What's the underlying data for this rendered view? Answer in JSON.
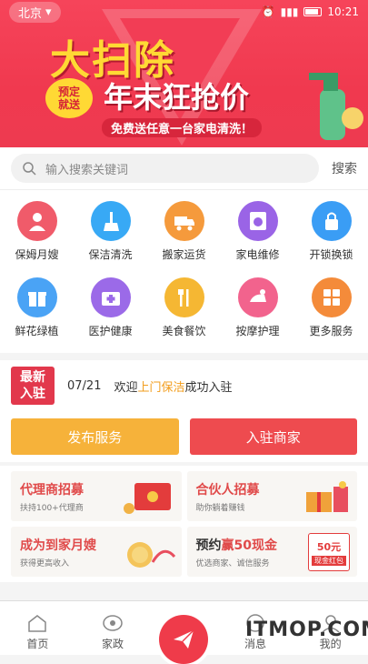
{
  "status_bar": {
    "location": "北京",
    "time": "10:21"
  },
  "banner": {
    "headline": "大扫除",
    "badge_line1": "预定",
    "badge_line2": "就送",
    "subheadline": "年末狂抢价",
    "promo": "免费送任意一台家电清洗！"
  },
  "search": {
    "placeholder": "输入搜索关键词",
    "button": "搜索"
  },
  "services": [
    {
      "label": "保姆月嫂",
      "color": "#f05b6a",
      "icon": "person-icon"
    },
    {
      "label": "保洁清洗",
      "color": "#38a9f5",
      "icon": "broom-icon"
    },
    {
      "label": "搬家运货",
      "color": "#f59a3c",
      "icon": "truck-icon"
    },
    {
      "label": "家电维修",
      "color": "#9a64e6",
      "icon": "washer-icon"
    },
    {
      "label": "开锁换锁",
      "color": "#3a9df5",
      "icon": "lock-icon"
    },
    {
      "label": "鲜花绿植",
      "color": "#4aa3f5",
      "icon": "gift-icon"
    },
    {
      "label": "医护健康",
      "color": "#9b6ae8",
      "icon": "medkit-icon"
    },
    {
      "label": "美食餐饮",
      "color": "#f5b733",
      "icon": "cutlery-icon"
    },
    {
      "label": "按摩护理",
      "color": "#f2638d",
      "icon": "massage-icon"
    },
    {
      "label": "更多服务",
      "color": "#f48b3a",
      "icon": "grid-icon"
    }
  ],
  "news": {
    "tag_line1": "最新",
    "tag_line2": "入驻",
    "date": "07/21",
    "text_before": "欢迎",
    "highlight": "上门保洁",
    "text_after": "成功入驻"
  },
  "actions": {
    "publish": "发布服务",
    "join": "入驻商家"
  },
  "cards": [
    {
      "title": "代理商招募",
      "subtitle": "扶持100+代理商"
    },
    {
      "title": "合伙人招募",
      "subtitle": "助你躺着赚钱"
    },
    {
      "title": "成为到家月嫂",
      "subtitle": "获得更高收入"
    },
    {
      "title_before": "预约",
      "title_highlight": "赢50现金",
      "subtitle": "优选商家、诚信服务",
      "coupon_amount": "50元",
      "coupon_label": "现金红包"
    }
  ],
  "tabs": [
    {
      "label": "首页"
    },
    {
      "label": "家政"
    },
    {
      "label": "消息"
    },
    {
      "label": "我的"
    }
  ],
  "watermark": "ITMOP.COM",
  "colors": {
    "brand_red": "#ef3b4a",
    "accent_orange": "#f6b23a",
    "highlight": "#f29d1c"
  }
}
